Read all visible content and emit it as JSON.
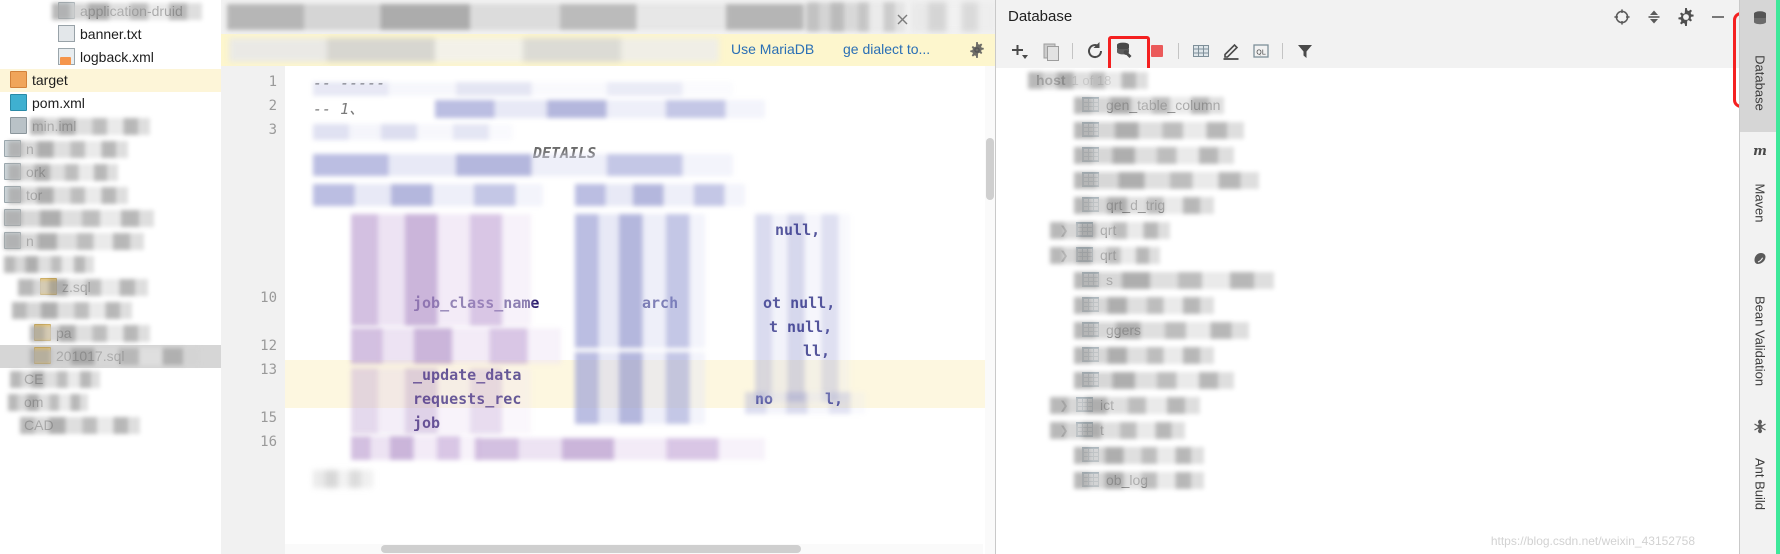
{
  "project_tree": {
    "items": [
      {
        "label": "application-druid",
        "icon": "file-icon",
        "redacted": true,
        "selected": "none"
      },
      {
        "label": "banner.txt",
        "icon": "text-file-icon",
        "redacted": false,
        "selected": "none"
      },
      {
        "label": "logback.xml",
        "icon": "xml-file-icon",
        "redacted": false,
        "selected": "none"
      },
      {
        "label": "target",
        "icon": "folder-icon",
        "redacted": false,
        "selected": "yellow"
      },
      {
        "label": "pom.xml",
        "icon": "maven-file-icon",
        "redacted": false,
        "selected": "none"
      },
      {
        "label": "min.iml",
        "icon": "iml-file-icon",
        "redacted": true,
        "selected": "none"
      },
      {
        "label": "n",
        "icon": "module-icon",
        "redacted": true,
        "selected": "none"
      },
      {
        "label": "ork",
        "icon": "module-icon",
        "redacted": true,
        "selected": "none"
      },
      {
        "label": "tor",
        "icon": "module-icon",
        "redacted": true,
        "selected": "none"
      },
      {
        "label": "",
        "icon": "module-icon",
        "redacted": true,
        "selected": "none"
      },
      {
        "label": "n",
        "icon": "module-icon",
        "redacted": true,
        "selected": "none"
      },
      {
        "label": "",
        "icon": "blank-icon",
        "redacted": true,
        "selected": "none"
      },
      {
        "label": "z.sql",
        "icon": "sql-file-icon",
        "redacted": true,
        "selected": "none"
      },
      {
        "label": "",
        "icon": "blank-icon",
        "redacted": true,
        "selected": "none"
      },
      {
        "label": "pa",
        "icon": "sql-file-icon",
        "redacted": true,
        "selected": "none"
      },
      {
        "label": "201017.sql",
        "icon": "sql-file-icon",
        "redacted": true,
        "selected": "grey"
      },
      {
        "label": "CE",
        "icon": "blank-icon",
        "redacted": true,
        "selected": "none"
      },
      {
        "label": "om",
        "icon": "blank-icon",
        "redacted": true,
        "selected": "none"
      },
      {
        "label": "CAD",
        "icon": "blank-icon",
        "redacted": true,
        "selected": "none"
      }
    ]
  },
  "editor": {
    "notification": {
      "link_primary": "Use MariaDB",
      "link_secondary": "ge dialect to...",
      "settings_icon": "gear-icon"
    },
    "line_numbers": [
      "1",
      "2",
      "3",
      "",
      "",
      "",
      "",
      "",
      "",
      "10",
      "",
      "12",
      "13",
      "",
      "15",
      "16",
      ""
    ],
    "code_tokens": [
      {
        "text": "-- -----",
        "kind": "comment"
      },
      {
        "text": "-- 1、",
        "kind": "comment"
      },
      {
        "text": "job_class_name",
        "kind": "identifier"
      },
      {
        "text": "arch",
        "kind": "keyword"
      },
      {
        "text": "ot null,",
        "kind": "keyword"
      },
      {
        "text": "t null,",
        "kind": "keyword"
      },
      {
        "text": "ll,",
        "kind": "keyword"
      },
      {
        "text": "null,",
        "kind": "keyword"
      },
      {
        "text": "_update_data",
        "kind": "identifier"
      },
      {
        "text": "requests_rec",
        "kind": "identifier"
      },
      {
        "text": "job",
        "kind": "identifier"
      },
      {
        "text": "no",
        "kind": "keyword"
      },
      {
        "text": "l,",
        "kind": "keyword"
      },
      {
        "text": "DETAILS",
        "kind": "comment"
      }
    ]
  },
  "database_panel": {
    "title": "Database",
    "header_actions": [
      {
        "name": "locate-icon",
        "glyph": "target"
      },
      {
        "name": "collapse-all-icon",
        "glyph": "collapse"
      },
      {
        "name": "gear-icon",
        "glyph": "gear"
      },
      {
        "name": "hide-icon",
        "glyph": "minus"
      }
    ],
    "toolbar_actions": [
      {
        "name": "add-datasource-button",
        "glyph": "plus",
        "highlighted": false
      },
      {
        "name": "duplicate-button",
        "glyph": "copy",
        "highlighted": false
      },
      {
        "name": "refresh-button",
        "glyph": "refresh",
        "highlighted": false
      },
      {
        "name": "data-source-properties-button",
        "glyph": "db-wrench",
        "highlighted": true
      },
      {
        "name": "stop-button",
        "glyph": "stop",
        "highlighted": false
      },
      {
        "name": "jump-to-console-button",
        "glyph": "table",
        "highlighted": false
      },
      {
        "name": "modify-button",
        "glyph": "pencil",
        "highlighted": false
      },
      {
        "name": "open-console-button",
        "glyph": "ql",
        "highlighted": false
      },
      {
        "name": "filter-button",
        "glyph": "funnel",
        "highlighted": false
      }
    ],
    "tree": [
      {
        "label": "host",
        "count": "1 of 18",
        "icon": "schema-icon",
        "expander": "none",
        "redacted": true,
        "bold": true
      },
      {
        "label": "gen_table_column",
        "count": "",
        "icon": "table-icon",
        "expander": "none",
        "redacted": true,
        "bold": false
      },
      {
        "label": "",
        "count": "",
        "icon": "table-icon",
        "expander": "none",
        "redacted": true,
        "bold": false
      },
      {
        "label": "",
        "count": "",
        "icon": "table-icon",
        "expander": "none",
        "redacted": true,
        "bold": false
      },
      {
        "label": "",
        "count": "",
        "icon": "table-icon",
        "expander": "none",
        "redacted": true,
        "bold": false
      },
      {
        "label": "qrt_d_trig",
        "count": "",
        "icon": "table-icon",
        "expander": "none",
        "redacted": true,
        "bold": false
      },
      {
        "label": "qrt",
        "count": "",
        "icon": "table-icon",
        "expander": "collapsed",
        "redacted": true,
        "bold": false
      },
      {
        "label": "qrt",
        "count": "",
        "icon": "table-icon",
        "expander": "collapsed",
        "redacted": true,
        "bold": false
      },
      {
        "label": "s",
        "count": "",
        "icon": "table-icon",
        "expander": "none",
        "redacted": true,
        "bold": false
      },
      {
        "label": "",
        "count": "",
        "icon": "table-icon",
        "expander": "none",
        "redacted": true,
        "bold": false
      },
      {
        "label": "ggers",
        "count": "",
        "icon": "table-icon",
        "expander": "none",
        "redacted": true,
        "bold": false
      },
      {
        "label": "",
        "count": "",
        "icon": "table-icon",
        "expander": "none",
        "redacted": true,
        "bold": false
      },
      {
        "label": "",
        "count": "",
        "icon": "table-icon",
        "expander": "none",
        "redacted": true,
        "bold": false
      },
      {
        "label": "ict",
        "count": "",
        "icon": "table-icon",
        "expander": "collapsed",
        "redacted": true,
        "bold": false
      },
      {
        "label": "t",
        "count": "",
        "icon": "table-icon",
        "expander": "collapsed",
        "redacted": true,
        "bold": false
      },
      {
        "label": "",
        "count": "",
        "icon": "table-icon",
        "expander": "none",
        "redacted": true,
        "bold": false
      },
      {
        "label": "ob_log",
        "count": "",
        "icon": "table-icon",
        "expander": "none",
        "redacted": true,
        "bold": false
      }
    ]
  },
  "tool_stripe": {
    "buttons": [
      {
        "label": "Database",
        "icon": "database-icon",
        "active": true
      },
      {
        "label": "Maven",
        "icon": "maven-m-icon",
        "active": false
      },
      {
        "label": "Bean Validation",
        "icon": "bean-icon",
        "active": false
      },
      {
        "label": "Ant Build",
        "icon": "ant-icon",
        "active": false
      }
    ]
  },
  "watermark": {
    "text": "https://blog.csdn.net/weixin_43152758"
  },
  "colors": {
    "annotation_red": "#f42020",
    "link_blue": "#2a6fb5",
    "notification_yellow": "#fdf6cd",
    "selection_yellow": "#fdf5d8",
    "accent_green": "#3ee89a"
  }
}
